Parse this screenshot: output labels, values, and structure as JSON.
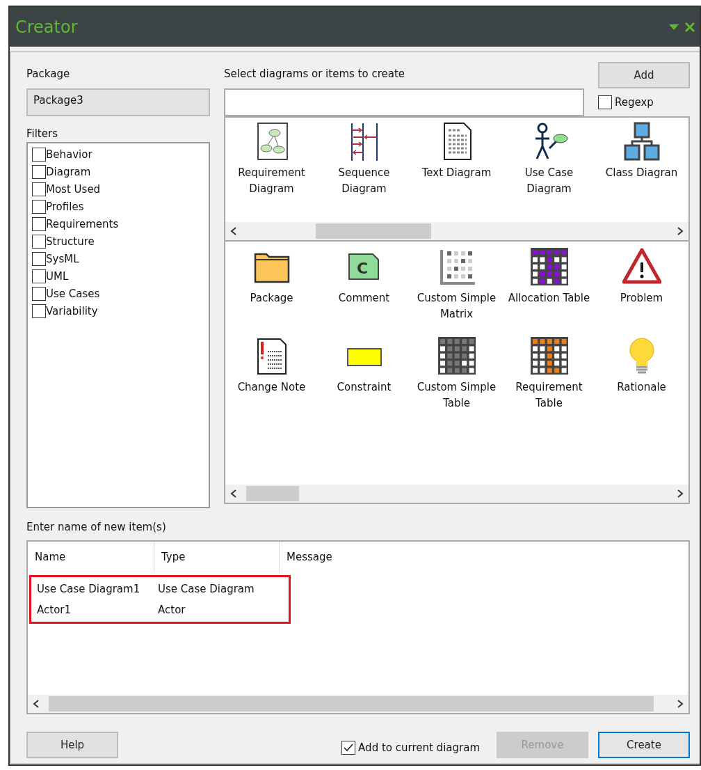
{
  "window": {
    "title": "Creator"
  },
  "package": {
    "label": "Package",
    "value": "Package3"
  },
  "search": {
    "label": "Select diagrams or items to create"
  },
  "add_button": "Add",
  "regexp": {
    "label": "Regexp",
    "checked": false
  },
  "filters": {
    "label": "Filters",
    "items": [
      {
        "label": "Behavior",
        "checked": false
      },
      {
        "label": "Diagram",
        "checked": false
      },
      {
        "label": "Most Used",
        "checked": false
      },
      {
        "label": "Profiles",
        "checked": false
      },
      {
        "label": "Requirements",
        "checked": false
      },
      {
        "label": "Structure",
        "checked": false
      },
      {
        "label": "SysML",
        "checked": false
      },
      {
        "label": "UML",
        "checked": false
      },
      {
        "label": "Use Cases",
        "checked": false
      },
      {
        "label": "Variability",
        "checked": false
      }
    ]
  },
  "diagrams": [
    {
      "kind": "requirement-diagram",
      "label": "Requirement Diagram"
    },
    {
      "kind": "sequence-diagram",
      "label": "Sequence Diagram"
    },
    {
      "kind": "text-diagram",
      "label": "Text Diagram"
    },
    {
      "kind": "use-case-diagram",
      "label": "Use Case Diagram"
    },
    {
      "kind": "class-diagram",
      "label": "Class Diagran"
    }
  ],
  "items": [
    {
      "kind": "package",
      "label": "Package"
    },
    {
      "kind": "comment",
      "label": "Comment",
      "icon_letter": "C"
    },
    {
      "kind": "matrix",
      "label": "Custom Simple Matrix"
    },
    {
      "kind": "purple-table",
      "label": "Allocation Table"
    },
    {
      "kind": "problem",
      "label": "Problem"
    },
    {
      "kind": "change-note",
      "label": "Change Note"
    },
    {
      "kind": "constraint",
      "label": "Constraint"
    },
    {
      "kind": "grey-table",
      "label": "Custom Simple Table"
    },
    {
      "kind": "orange-table",
      "label": "Requirement Table"
    },
    {
      "kind": "rationale",
      "label": "Rationale"
    }
  ],
  "new_items": {
    "label": "Enter name of new item(s)",
    "columns": [
      "Name",
      "Type",
      "Message"
    ],
    "highlighted": true,
    "rows": [
      {
        "name": "Use Case Diagram1",
        "type": "Use Case Diagram"
      },
      {
        "name": "Actor1",
        "type": "Actor"
      }
    ]
  },
  "footer": {
    "help": "Help",
    "add_to_current": {
      "label": "Add to current diagram",
      "checked": true
    },
    "remove": {
      "label": "Remove",
      "disabled": true
    },
    "create": "Create"
  }
}
